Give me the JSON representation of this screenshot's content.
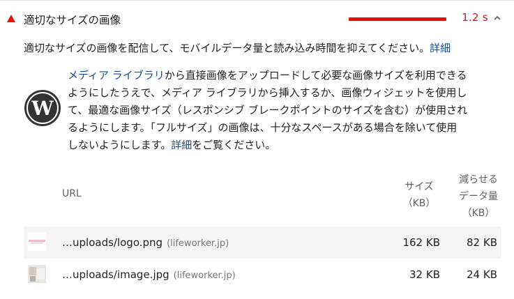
{
  "audit": {
    "title": "適切なサイズの画像",
    "metric": "1.2 s",
    "status_color": "#eb0f00"
  },
  "description": {
    "text": "適切なサイズの画像を配信して、モバイルデータ量と読み込み時間を抑えてください。",
    "link": "詳細"
  },
  "wordpress": {
    "logo_icon": "wordpress-logo-icon",
    "line1_link": "メディア ライブラリ",
    "line1_rest": "から直接画像をアップロードして必要な画像サイズを利用できる",
    "line2": "ようにしたうえで、メディア ライブラリから挿入するか、画像ウィジェットを使用し",
    "line3": "て、最適な画像サイズ（レスポンシブ ブレークポイントのサイズを含む）が使用され",
    "line4": "るようにします。「フルサイズ」の画像は、十分なスペースがある場合を除いて使用",
    "line5_pre": "しないようにします。",
    "line5_link": "詳細",
    "line5_post": "をご覧ください。"
  },
  "table": {
    "headers": {
      "url": "URL",
      "size_line1": "サイズ",
      "size_line2": "（KB）",
      "savings_line1": "減らせる",
      "savings_line2": "データ量",
      "savings_line3": "（KB）"
    },
    "rows": [
      {
        "url": "…uploads/logo.png",
        "host": "(lifeworker.jp)",
        "size": "162 KB",
        "savings": "82 KB"
      },
      {
        "url": "…uploads/image.jpg",
        "host": "(lifeworker.jp)",
        "size": "32 KB",
        "savings": "24 KB"
      }
    ]
  }
}
